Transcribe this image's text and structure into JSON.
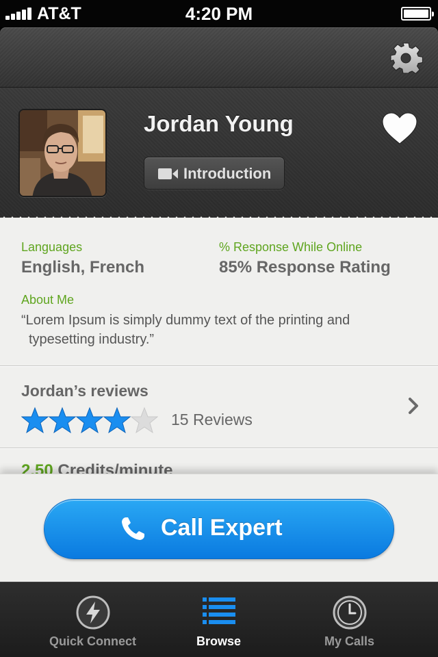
{
  "status_bar": {
    "carrier": "AT&T",
    "time": "4:20 PM",
    "battery_level": 1.0
  },
  "top_bar": {
    "settings_icon": "gear-icon"
  },
  "profile": {
    "name": "Jordan Young",
    "intro_button": "Introduction",
    "intro_icon": "video-camera-icon",
    "favorite_icon": "heart-icon"
  },
  "details": {
    "languages_label": "Languages",
    "languages_value": "English, French",
    "response_label": "% Response While Online",
    "response_value": "85% Response Rating",
    "about_label": "About Me",
    "about_line1": "“Lorem Ipsum is simply dummy text of the printing and",
    "about_line2": "typesetting industry.”"
  },
  "reviews": {
    "title": "Jordan’s reviews",
    "rating": 4,
    "max_rating": 5,
    "count_text": "15 Reviews"
  },
  "pricing": {
    "credits_value": "2.50",
    "credits_unit": "Credits/minute"
  },
  "call_button": {
    "label": "Call Expert",
    "icon": "phone-icon"
  },
  "tabs": [
    {
      "label": "Quick Connect",
      "icon": "lightning-icon",
      "active": false
    },
    {
      "label": "Browse",
      "icon": "list-icon",
      "active": true
    },
    {
      "label": "My Calls",
      "icon": "clock-icon",
      "active": false
    }
  ],
  "colors": {
    "accent_green": "#5fa51f",
    "call_blue": "#0a7ae0",
    "star_blue": "#1a8ef0"
  }
}
